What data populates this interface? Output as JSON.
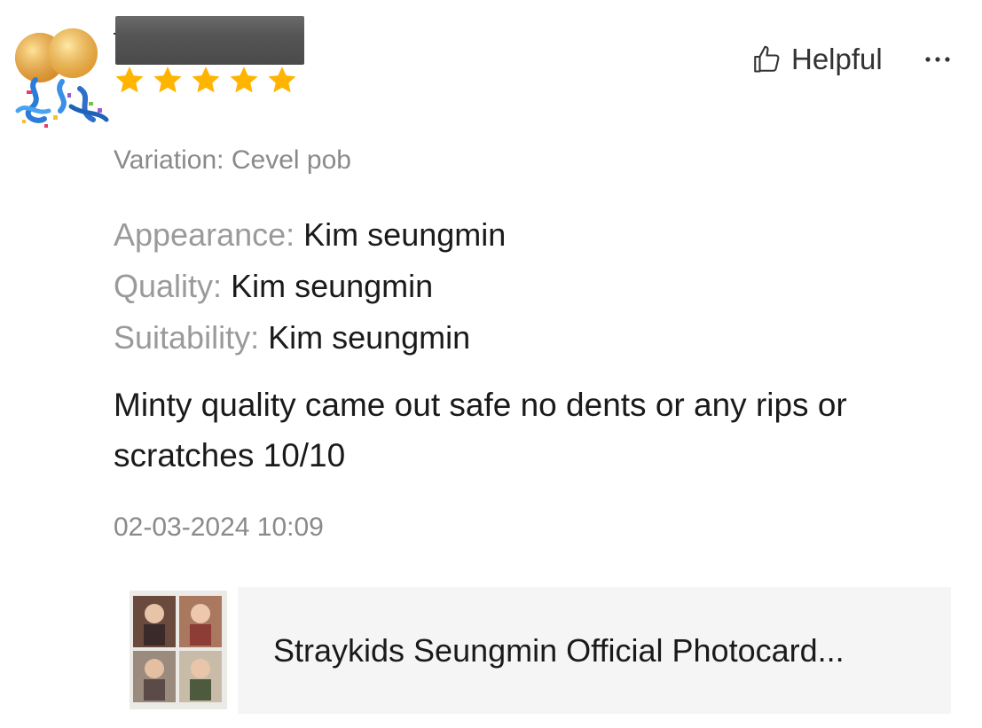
{
  "review": {
    "rating": 5,
    "rating_max": 5,
    "helpful_label": "Helpful",
    "variation": "Variation: Cevel pob",
    "attributes": [
      {
        "key": "Appearance:",
        "value": "Kim seungmin"
      },
      {
        "key": "Quality:",
        "value": "Kim seungmin"
      },
      {
        "key": "Suitability:",
        "value": "Kim seungmin"
      }
    ],
    "text": "Minty quality came out safe no dents or any rips or scratches 10/10",
    "date": "02-03-2024 10:09"
  },
  "product": {
    "title": "Straykids Seungmin Official Photocard..."
  },
  "colors": {
    "star": "#FFB400",
    "label_gray": "#8a8a8a",
    "product_bg": "#f5f5f5"
  },
  "icons": {
    "helpful": "thumbs-up-icon",
    "more": "more-horizontal-icon"
  }
}
